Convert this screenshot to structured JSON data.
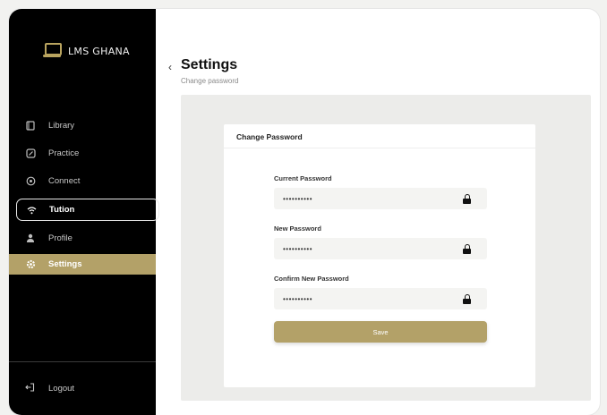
{
  "sidebar": {
    "brand": "LMS GHANA",
    "items": [
      {
        "label": "Library",
        "icon": "book-icon"
      },
      {
        "label": "Practice",
        "icon": "edit-icon"
      },
      {
        "label": "Connect",
        "icon": "connect-icon"
      },
      {
        "label": "Tution",
        "icon": "wifi-icon"
      },
      {
        "label": "Profile",
        "icon": "user-icon"
      },
      {
        "label": "Settings",
        "icon": "gear-icon"
      }
    ],
    "logout": "Logout"
  },
  "header": {
    "title": "Settings",
    "subtitle": "Change password"
  },
  "card": {
    "title": "Change Password",
    "fields": [
      {
        "label": "Current Password",
        "value": "••••••••••"
      },
      {
        "label": "New Password",
        "value": "••••••••••"
      },
      {
        "label": "Confirm New Password",
        "value": "••••••••••"
      }
    ],
    "save_label": "Save"
  },
  "colors": {
    "accent": "#b3a168",
    "sidebar_bg": "#000000"
  }
}
